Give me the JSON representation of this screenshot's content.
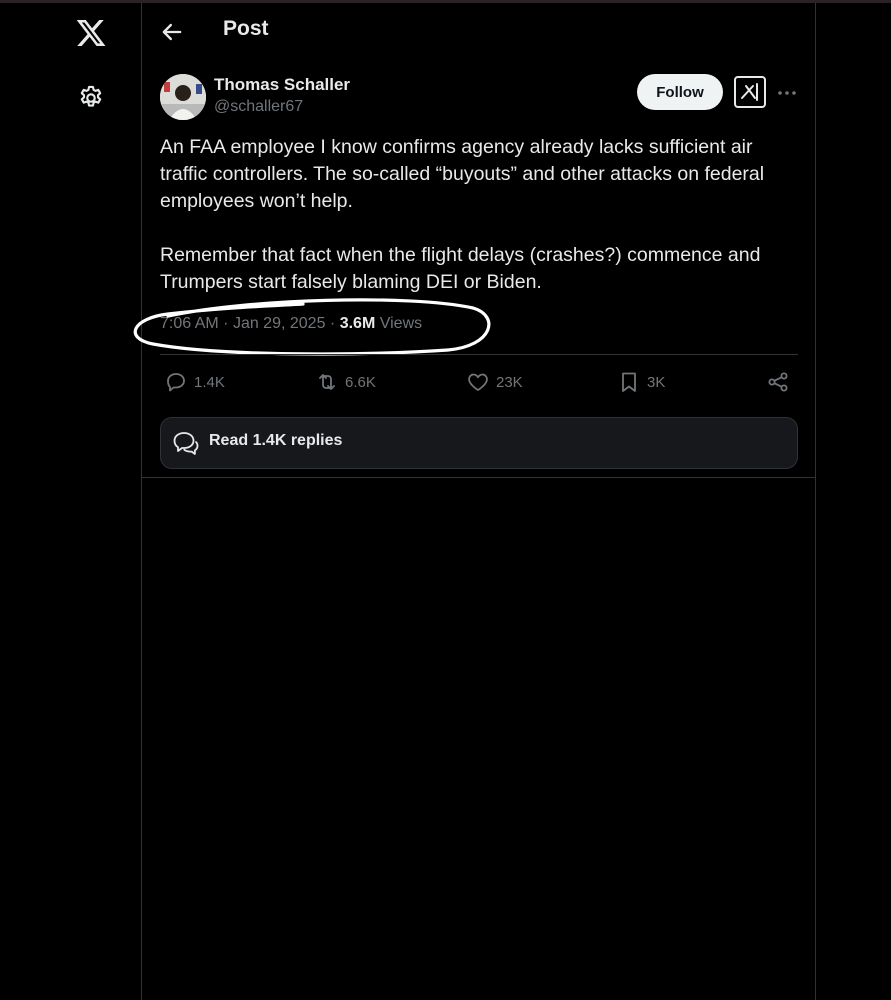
{
  "header": {
    "title": "Post"
  },
  "author": {
    "name": "Thomas Schaller",
    "handle": "@schaller67"
  },
  "buttons": {
    "follow": "Follow"
  },
  "post": {
    "paragraphs": [
      "An FAA employee I know confirms agency already lacks sufficient air traffic controllers. The so-called “buyouts” and other attacks on federal employees won’t help.",
      "Remember that fact when the flight delays (crashes?) commence and Trumpers start falsely blaming DEI or Biden."
    ],
    "time": "7:06 AM",
    "date": "Jan 29, 2025",
    "views_count": "3.6M",
    "views_label": "Views"
  },
  "actions": {
    "replies": "1.4K",
    "reposts": "6.6K",
    "likes": "23K",
    "bookmarks": "3K"
  },
  "read_replies_label": "Read 1.4K replies",
  "icons": [
    "x-logo-icon",
    "gear-icon",
    "back-arrow-icon",
    "grok-icon",
    "more-icon",
    "reply-icon",
    "repost-icon",
    "like-icon",
    "bookmark-icon",
    "share-icon",
    "chat-bubbles-icon"
  ],
  "colors": {
    "background": "#000000",
    "text": "#e7e9ea",
    "secondary": "#71767b",
    "border": "#2f3336",
    "follow_bg": "#eff3f4"
  }
}
